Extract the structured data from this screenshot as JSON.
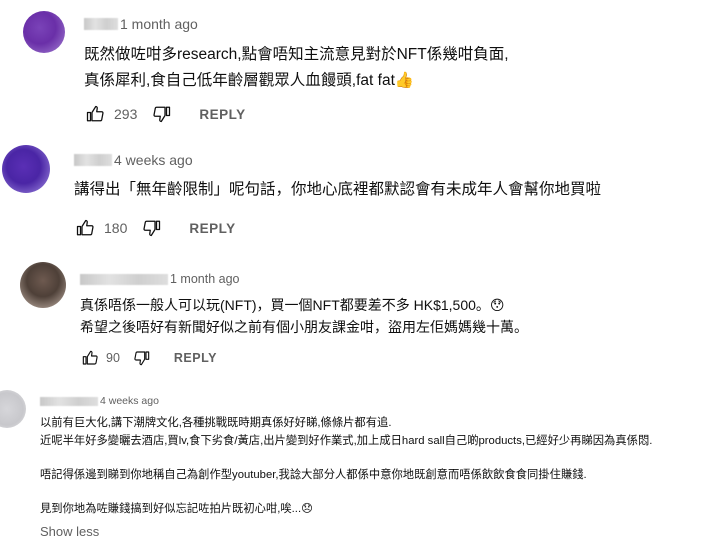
{
  "comments": [
    {
      "time": "1 month ago",
      "lines": [
        "既然做咗咁多research,點會唔知主流意見對於NFT係幾咁負面,",
        "真係犀利,食自己低年齡層觀眾人血饅頭,fat fat👍"
      ],
      "likes": "293",
      "reply_label": "REPLY"
    },
    {
      "time": "4 weeks ago",
      "lines": [
        "講得出「無年齡限制」呢句話，你地心底裡都默認會有未成年人會幫你地買啦"
      ],
      "likes": "180",
      "reply_label": "REPLY"
    },
    {
      "time": "1 month ago",
      "lines": [
        "真係唔係一般人可以玩(NFT)，買一個NFT都要差不多 HK$1,500。😯",
        "希望之後唔好有新聞好似之前有個小朋友課金咁，盜用左佢媽媽幾十萬。"
      ],
      "likes": "90",
      "reply_label": "REPLY"
    },
    {
      "time": "4 weeks ago",
      "lines": [
        "以前有巨大化,講下潮牌文化,各種挑戰既時期真係好好睇,條條片都有追.",
        "近呢半年好多變曬去酒店,買lv,食下劣食/黃店,出片變到好作業式,加上成日hard sall自己啲products,已經好少再睇因為真係悶.",
        "唔記得係邊到睇到你地稱自己為創作型youtuber,我諗大部分人都係中意你地既創意而唔係飲飲食食同掛住賺錢.",
        "見到你地為咗賺錢搞到好似忘記咗拍片既初心咁,唉...😞"
      ]
    }
  ],
  "show_less_label": "Show less",
  "icons": {
    "like": "thumbs-up-icon",
    "dislike": "thumbs-down-icon"
  }
}
